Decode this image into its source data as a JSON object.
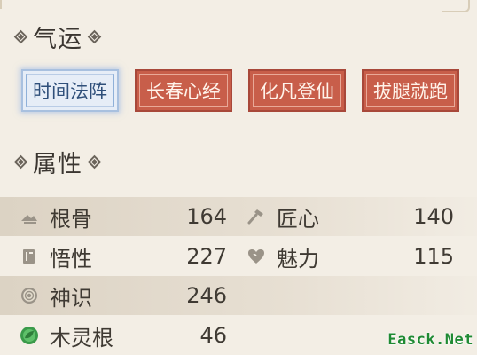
{
  "sections": {
    "qiyun": {
      "title": "气运"
    },
    "shuxing": {
      "title": "属性"
    }
  },
  "fortune_tags": [
    {
      "label": "时间法阵",
      "state": "selected"
    },
    {
      "label": "长春心经",
      "state": "normal"
    },
    {
      "label": "化凡登仙",
      "state": "normal"
    },
    {
      "label": "拔腿就跑",
      "state": "normal"
    }
  ],
  "stats": {
    "root_bone": {
      "name": "根骨",
      "value": "164",
      "icon": "mountain-icon"
    },
    "craft": {
      "name": "匠心",
      "value": "140",
      "icon": "hammer-icon"
    },
    "comprehension": {
      "name": "悟性",
      "value": "227",
      "icon": "book-icon"
    },
    "charm": {
      "name": "魅力",
      "value": "115",
      "icon": "heart-icon"
    },
    "spirit": {
      "name": "神识",
      "value": "246",
      "icon": "spiral-icon"
    },
    "wood_root": {
      "name": "木灵根",
      "value": "46",
      "icon": "wood-leaf-icon"
    }
  },
  "colors": {
    "background": "#f3eee5",
    "tag_red": "#c85e4a",
    "tag_selected": "#e6edf7",
    "row_shade": "#d8cebe",
    "wood_green": "#3a9a4a"
  },
  "watermark": "Easck.Net"
}
